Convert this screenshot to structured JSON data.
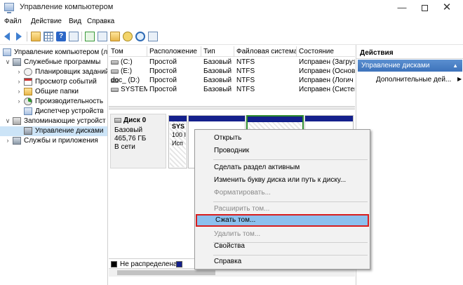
{
  "window": {
    "title": "Управление компьютером",
    "minimize": "—",
    "close": "✕"
  },
  "menu": [
    "Файл",
    "Действие",
    "Вид",
    "Справка"
  ],
  "tree": [
    {
      "label": "Управление компьютером (л",
      "toggle": "",
      "depth": 0
    },
    {
      "label": "Служебные программы",
      "toggle": "∨",
      "depth": 1
    },
    {
      "label": "Планировщик заданий",
      "toggle": "›",
      "depth": 2
    },
    {
      "label": "Просмотр событий",
      "toggle": "›",
      "depth": 2
    },
    {
      "label": "Общие папки",
      "toggle": "›",
      "depth": 2
    },
    {
      "label": "Производительность",
      "toggle": "›",
      "depth": 2
    },
    {
      "label": "Диспетчер устройств",
      "toggle": "",
      "depth": 2
    },
    {
      "label": "Запоминающие устройст",
      "toggle": "∨",
      "depth": 1
    },
    {
      "label": "Управление дисками",
      "toggle": "",
      "depth": 2,
      "selected": true
    },
    {
      "label": "Службы и приложения",
      "toggle": "›",
      "depth": 1
    }
  ],
  "volumes": {
    "headers": [
      "Том",
      "Расположение",
      "Тип",
      "Файловая система",
      "Состояние"
    ],
    "rows": [
      [
        "(C:)",
        "Простой",
        "Базовый",
        "NTFS",
        "Исправен (Загруз"
      ],
      [
        "(E:)",
        "Простой",
        "Базовый",
        "NTFS",
        "Исправен (Основ"
      ],
      [
        "doc_ (D:)",
        "Простой",
        "Базовый",
        "NTFS",
        "Исправен (Логич"
      ],
      [
        "SYSTEM",
        "Простой",
        "Базовый",
        "NTFS",
        "Исправен (Систем"
      ]
    ]
  },
  "disk": {
    "name": "Диск 0",
    "type": "Базовый",
    "size": "465,76 ГБ",
    "status": "В сети",
    "partition_lines": [
      "SYS",
      "100 I",
      "Исп"
    ]
  },
  "legend": {
    "unallocated": "Не распределена",
    "unallocated_color": "#000000",
    "primary_color": "#14208c"
  },
  "actions": {
    "header": "Действия",
    "section": "Управление дисками",
    "section_caret": "▲",
    "item": "Дополнительные дей...",
    "item_arrow": "▶"
  },
  "context_menu": [
    {
      "label": "Открыть",
      "disabled": false
    },
    {
      "label": "Проводник",
      "disabled": false
    },
    {
      "sep": true
    },
    {
      "label": "Сделать раздел активным",
      "disabled": false
    },
    {
      "label": "Изменить букву диска или путь к диску...",
      "disabled": false
    },
    {
      "label": "Форматировать...",
      "disabled": true
    },
    {
      "sep": true
    },
    {
      "label": "Расширить том...",
      "disabled": true
    },
    {
      "label": "Сжать том...",
      "disabled": false,
      "highlighted": true
    },
    {
      "label": "Удалить том...",
      "disabled": true
    },
    {
      "sep": true
    },
    {
      "label": "Свойства",
      "disabled": false
    },
    {
      "sep": true
    },
    {
      "label": "Справка",
      "disabled": false
    }
  ],
  "icons": [
    "back-arrow-icon",
    "forward-arrow-icon",
    "up-folder-icon",
    "show-hide-tree-icon",
    "help-icon",
    "properties-icon",
    "refresh-icon",
    "export-icon",
    "open-folder-icon",
    "key-icon",
    "search-icon"
  ],
  "colors": {
    "selection": "#cce4f7",
    "actions_section": "#3d73bb",
    "highlight_item": "#8cc0ee",
    "highlight_border": "#d81e1e"
  }
}
